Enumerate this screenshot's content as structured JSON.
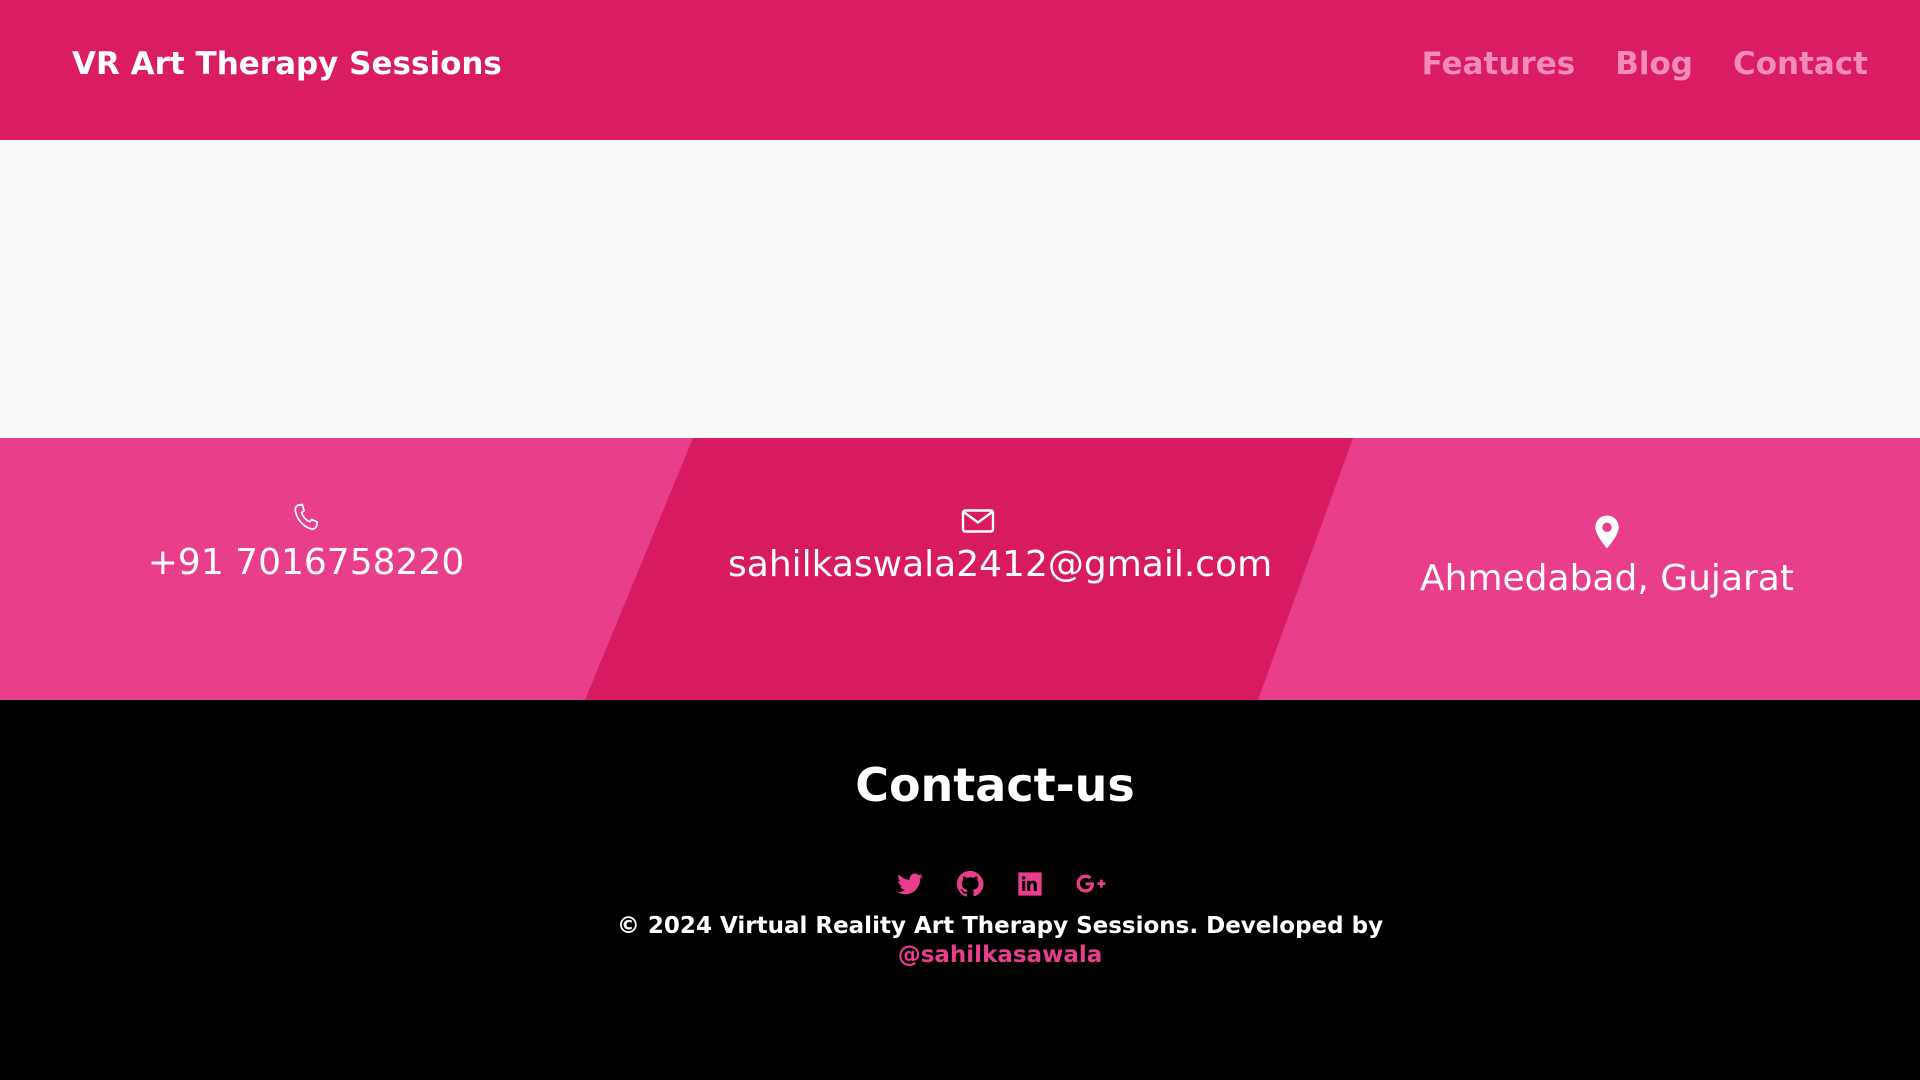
{
  "navbar": {
    "brand": "VR Art Therapy Sessions",
    "links": [
      "Features",
      "Blog",
      "Contact"
    ],
    "background": "#da1c62",
    "link_color": "#f38bb8"
  },
  "contact_strip": {
    "items": [
      {
        "icon": "phone-icon",
        "text": "+91 7016758220"
      },
      {
        "icon": "mail-icon",
        "text": "sahilkaswala2412@gmail.com"
      },
      {
        "icon": "map-pin-icon",
        "text": "Ahmedabad, Gujarat"
      }
    ],
    "colors": {
      "side": "#e83e8c",
      "middle": "#d81b60"
    }
  },
  "footer": {
    "title": "Contact-us",
    "socials": [
      "twitter-icon",
      "github-icon",
      "linkedin-icon",
      "google-plus-icon"
    ],
    "copyright": "© 2024 Virtual Reality Art Therapy Sessions. Developed by",
    "handle": "@sahilkasawala",
    "accent": "#e83e8c"
  }
}
